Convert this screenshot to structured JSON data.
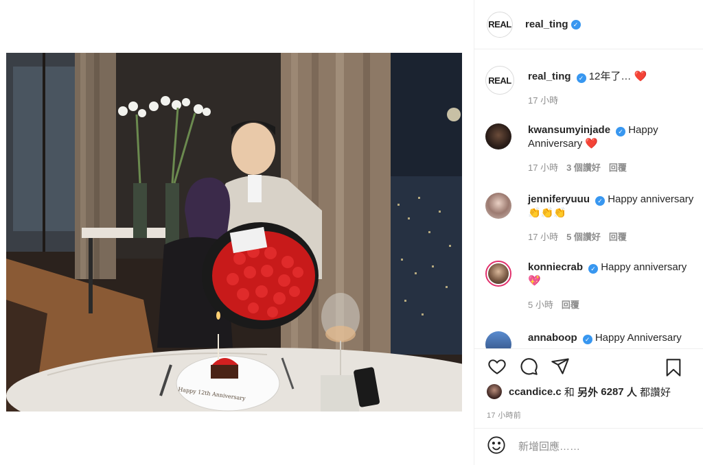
{
  "post": {
    "author": "real_ting",
    "avatar_text": "REAL"
  },
  "caption": {
    "username": "real_ting",
    "text": "12年了…",
    "time": "17 小時"
  },
  "comments": [
    {
      "username": "kwansumyinjade",
      "text": "Happy Anniversary",
      "time": "17 小時",
      "likes": "3 個讚好",
      "reply": "回覆"
    },
    {
      "username": "jenniferyuuu",
      "text": "Happy anniversary",
      "emoji": "👏👏👏",
      "time": "17 小時",
      "likes": "5 個讚好",
      "reply": "回覆"
    },
    {
      "username": "konniecrab",
      "text": "Happy anniversary",
      "time": "5 小時",
      "reply": "回覆"
    },
    {
      "username": "annaboop",
      "text": "Happy Anniversary"
    }
  ],
  "likes_summary": {
    "liker": "ccandice.c",
    "connector": "和",
    "others_prefix": "另外",
    "count": "6287",
    "unit": "人",
    "suffix": "都讚好"
  },
  "post_time": "17 小時前",
  "add_comment": {
    "placeholder": "新增回應……"
  },
  "photo": {
    "plate_text": "Happy 12th Anniversary"
  },
  "colors": {
    "verified": "#3897f0",
    "heart": "#ed1c24",
    "muted": "#8e8e8e"
  },
  "icons": [
    "verified-icon",
    "heart-icon",
    "comment-icon",
    "share-icon",
    "bookmark-icon",
    "emoji-icon"
  ]
}
